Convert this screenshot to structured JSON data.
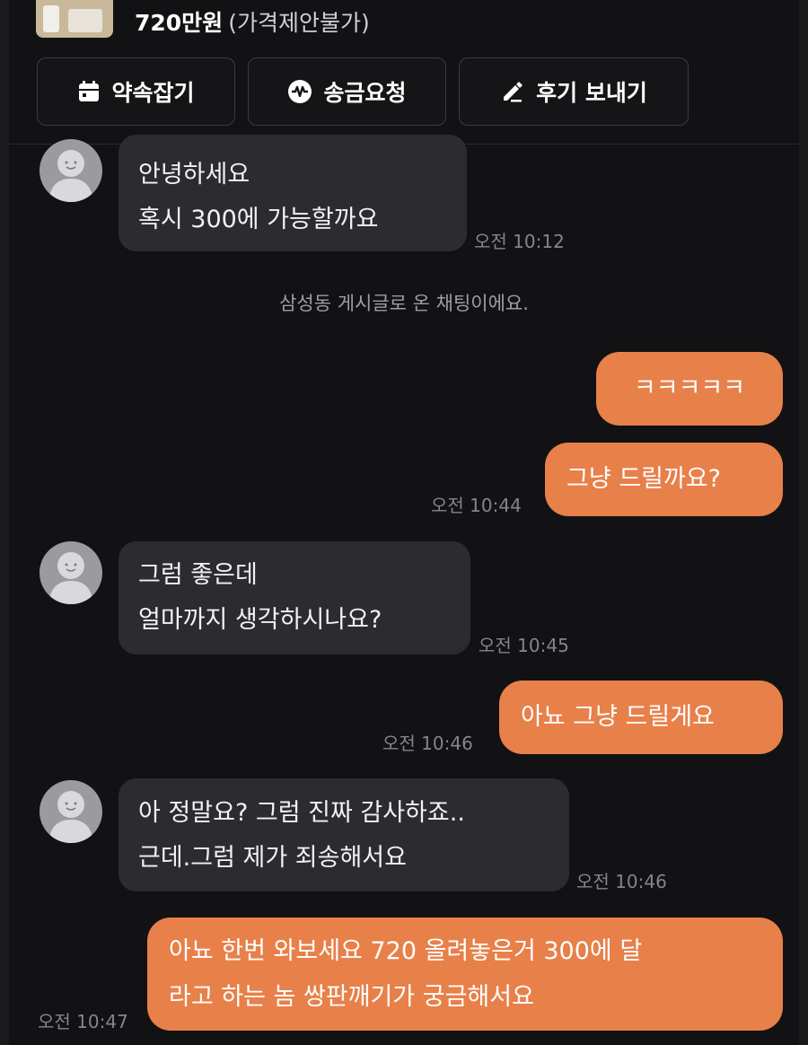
{
  "product": {
    "price": "720만원",
    "price_note": "(가격제안불가)"
  },
  "actions": [
    {
      "label": "약속잡기",
      "icon": "calendar-icon"
    },
    {
      "label": "송금요청",
      "icon": "pay-icon"
    },
    {
      "label": "후기 보내기",
      "icon": "pencil-icon"
    }
  ],
  "messages": [
    {
      "from": "other",
      "lines": [
        "안녕하세요",
        "혹시 300에 가능할까요"
      ],
      "time": "오전 10:12"
    },
    {
      "from": "system",
      "text": "삼성동 게시글로 온 채팅이에요."
    },
    {
      "from": "me",
      "text": "ㅋㅋㅋㅋㅋ"
    },
    {
      "from": "me",
      "text": "그냥 드릴까요?",
      "time": "오전 10:44"
    },
    {
      "from": "other",
      "lines": [
        "그럼 좋은데",
        "얼마까지 생각하시나요?"
      ],
      "time": "오전 10:45"
    },
    {
      "from": "me",
      "text": "아뇨 그냥 드릴게요",
      "time": "오전 10:46"
    },
    {
      "from": "other",
      "lines": [
        "아 정말요? 그럼 진짜 감사하죠..",
        "근데.그럼 제가 죄송해서요"
      ],
      "time": "오전 10:46"
    },
    {
      "from": "me",
      "lines": [
        "아뇨 한번 와보세요 720 올려놓은거 300에 달",
        "라고 하는 놈 쌍판깨기가 궁금해서요"
      ],
      "time": "오전 10:47"
    }
  ],
  "colors": {
    "outgoing_bubble": "#e8804a",
    "incoming_bubble": "#2c2c30",
    "background": "#121214"
  }
}
